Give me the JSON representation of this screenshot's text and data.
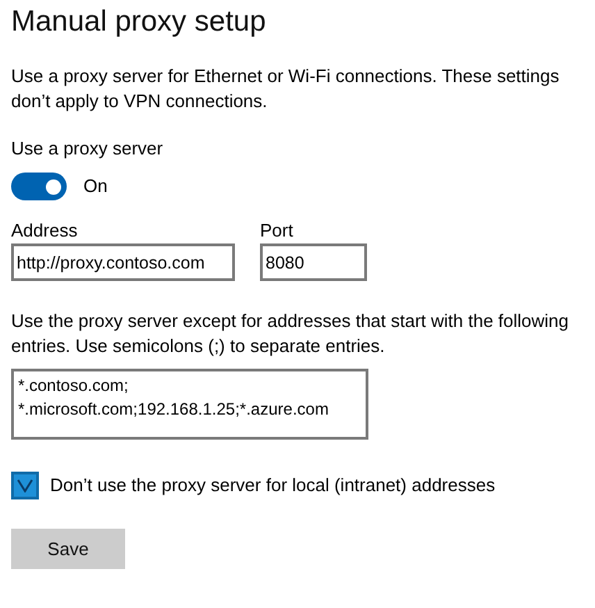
{
  "title": "Manual proxy setup",
  "description": "Use a proxy server for Ethernet or Wi-Fi connections. These settings don’t apply to VPN connections.",
  "proxy_toggle": {
    "label": "Use a proxy server",
    "on": true,
    "state_text": "On"
  },
  "address": {
    "label": "Address",
    "value": "http://proxy.contoso.com"
  },
  "port": {
    "label": "Port",
    "value": "8080"
  },
  "exceptions": {
    "label": "Use the proxy server except for addresses that start with the following entries. Use semicolons (;) to separate entries.",
    "value": "*.contoso.com; *.microsoft.com;192.168.1.25;*.azure.com"
  },
  "bypass_local": {
    "label": "Don’t use the proxy server for local (intranet) addresses",
    "checked": true
  },
  "save_button": "Save"
}
